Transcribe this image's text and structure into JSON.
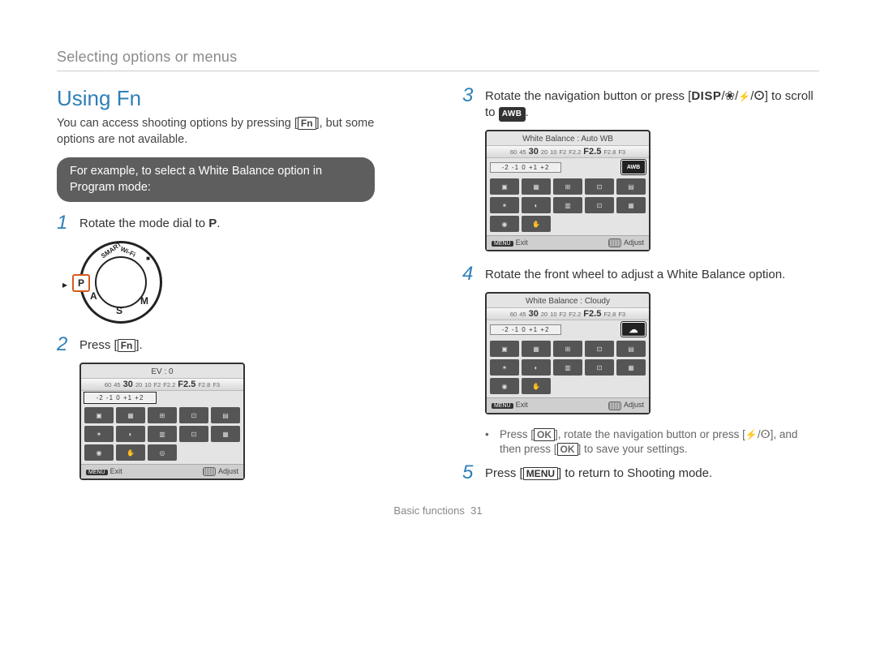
{
  "header": {
    "breadcrumb": "Selecting options or menus"
  },
  "section": {
    "title": "Using Fn"
  },
  "intro": {
    "prefix": "You can access shooting options by pressing [",
    "fn": "Fn",
    "suffix": "], but some options are not available."
  },
  "example_pill": "For example, to select a White Balance option in Program mode:",
  "steps": {
    "s1": {
      "num": "1",
      "text_pre": "Rotate the mode dial to ",
      "p": "P",
      "text_post": "."
    },
    "s2": {
      "num": "2",
      "text_pre": "Press [",
      "fn": "Fn",
      "text_post": "]."
    },
    "s3": {
      "num": "3",
      "text_pre": "Rotate the navigation button or press [",
      "disp": "DISP",
      "sep": "/",
      "text_mid": "] to scroll to ",
      "awb": "AWB",
      "text_post": "."
    },
    "s4": {
      "num": "4",
      "text": "Rotate the front wheel to adjust a White Balance option."
    },
    "s5": {
      "num": "5",
      "text_pre": "Press [",
      "menu": "MENU",
      "text_post": "] to return to Shooting mode."
    }
  },
  "note": {
    "bullet": "•",
    "a": "Press [",
    "ok1": "OK",
    "b": "], rotate the navigation button or press [",
    "c": "], and then press [",
    "ok2": "OK",
    "d": "] to save your settings."
  },
  "lcd_common": {
    "shutter_strip": {
      "v60": "60",
      "v45": "45",
      "v30": "30",
      "v20": "20",
      "v10": "10",
      "f2": "F2",
      "f22": "F2.2",
      "f25": "F2.5",
      "f28": "F2.8",
      "f3": "F3"
    },
    "ev_scale": "-2 -1 0 +1 +2",
    "footer_exit": "Exit",
    "footer_adjust": "Adjust",
    "footer_menu_tag": "MENU"
  },
  "lcd1": {
    "title": "EV : 0"
  },
  "lcd2": {
    "title": "White Balance : Auto WB",
    "sel_label": "AWB"
  },
  "lcd3": {
    "title": "White Balance : Cloudy",
    "sel_label": "☁"
  },
  "dial": {
    "p": "P",
    "smart": "SMART",
    "wifi": "Wi-Fi",
    "a": "A",
    "s": "S",
    "m": "M"
  },
  "footer": {
    "section": "Basic functions",
    "page": "31"
  }
}
